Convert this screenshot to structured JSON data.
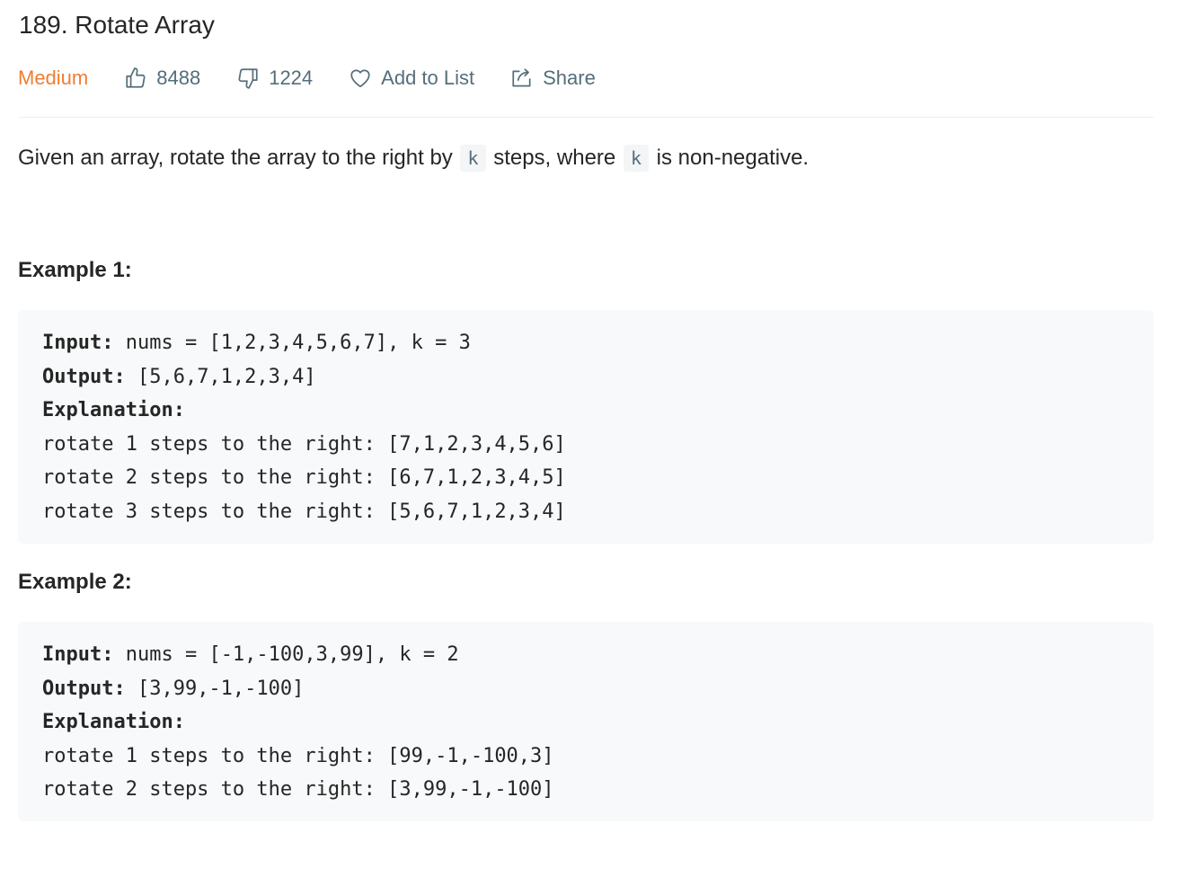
{
  "problem": {
    "title": "189. Rotate Array",
    "difficulty": "Medium",
    "likes": "8488",
    "dislikes": "1224",
    "favorite_label": "Add to List",
    "share_label": "Share"
  },
  "description": {
    "part1": "Given an array, rotate the array to the right by",
    "code1": "k",
    "part2": "steps, where",
    "code2": "k",
    "part3": "is non-negative."
  },
  "examples": [
    {
      "heading": "Example 1:",
      "input_label": "Input:",
      "input_value": " nums = [1,2,3,4,5,6,7], k = 3",
      "output_label": "Output:",
      "output_value": " [5,6,7,1,2,3,4]",
      "explanation_label": "Explanation:",
      "explanation_lines": [
        "rotate 1 steps to the right: [7,1,2,3,4,5,6]",
        "rotate 2 steps to the right: [6,7,1,2,3,4,5]",
        "rotate 3 steps to the right: [5,6,7,1,2,3,4]"
      ]
    },
    {
      "heading": "Example 2:",
      "input_label": "Input:",
      "input_value": " nums = [-1,-100,3,99], k = 2",
      "output_label": "Output:",
      "output_value": " [3,99,-1,-100]",
      "explanation_label": "Explanation:",
      "explanation_lines": [
        "rotate 1 steps to the right: [99,-1,-100,3]",
        "rotate 2 steps to the right: [3,99,-1,-100]"
      ]
    }
  ],
  "colors": {
    "difficulty_medium": "#ef7d31",
    "meta_text": "#546e7a",
    "code_background": "#f7f9fa"
  },
  "icons": {
    "likes": "thumbs-up-icon",
    "dislikes": "thumbs-down-icon",
    "favorite": "heart-icon",
    "share": "share-icon"
  }
}
